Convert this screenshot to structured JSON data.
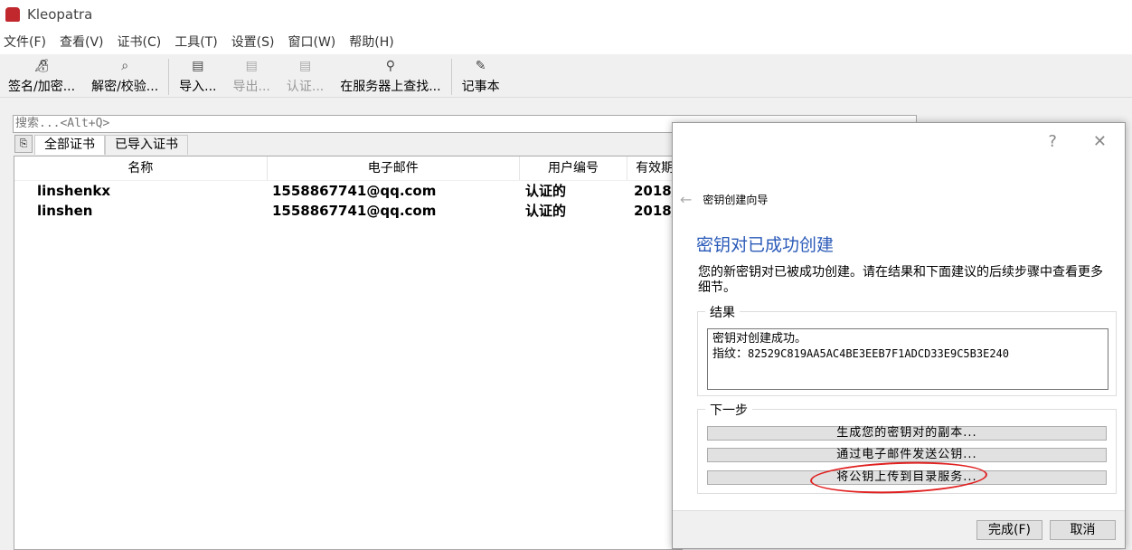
{
  "app": {
    "title": "Kleopatra"
  },
  "menu": [
    "文件(F)",
    "查看(V)",
    "证书(C)",
    "工具(T)",
    "设置(S)",
    "窗口(W)",
    "帮助(H)"
  ],
  "toolbar": [
    {
      "label": "签名/加密...",
      "icon": "sign-encrypt-icon",
      "enabled": true
    },
    {
      "label": "解密/校验...",
      "icon": "decrypt-verify-icon",
      "enabled": true
    },
    {
      "label": "导入...",
      "icon": "import-icon",
      "enabled": true
    },
    {
      "label": "导出...",
      "icon": "export-icon",
      "enabled": false
    },
    {
      "label": "认证...",
      "icon": "certify-icon",
      "enabled": false
    },
    {
      "label": "在服务器上查找...",
      "icon": "search-icon",
      "enabled": true
    },
    {
      "label": "记事本",
      "icon": "pencil-icon",
      "enabled": true
    }
  ],
  "search": {
    "placeholder": "搜索...<Alt+Q>"
  },
  "tabs": [
    "全部证书",
    "已导入证书"
  ],
  "table": {
    "columns": [
      "名称",
      "电子邮件",
      "用户编号",
      "有效期"
    ],
    "rows": [
      [
        "linshenkx",
        "1558867741@qq.com",
        "认证的",
        "2018/"
      ],
      [
        "linshen",
        "1558867741@qq.com",
        "认证的",
        "2018/"
      ]
    ]
  },
  "dialog": {
    "help": "?",
    "close": "✕",
    "breadcrumb": "密钥创建向导",
    "heading": "密钥对已成功创建",
    "description": "您的新密钥对已被成功创建。请在结果和下面建议的后续步骤中查看更多细节。",
    "result_label": "结果",
    "result_line1": "密钥对创建成功。",
    "result_line2_label": "指纹：",
    "fingerprint": "82529C819AA5AC4BE3EEB7F1ADCD33E9C5B3E240",
    "next_label": "下一步",
    "next_buttons": [
      "生成您的密钥对的副本...",
      "通过电子邮件发送公钥...",
      "将公钥上传到目录服务..."
    ],
    "finish": "完成(F)",
    "cancel": "取消"
  },
  "colors": {
    "heading": "#2a5ab8",
    "annotation": "#e02020"
  }
}
